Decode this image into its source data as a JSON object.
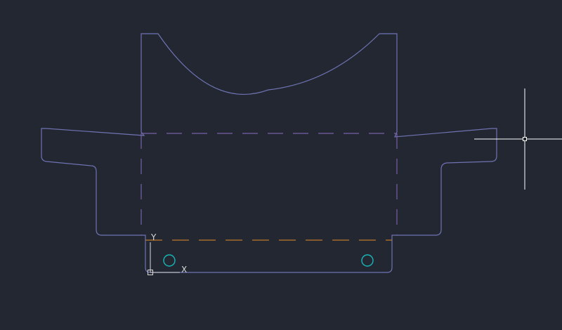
{
  "canvas": {
    "background": "#222732"
  },
  "colors": {
    "outline": "#6f73b2",
    "hidden_purple": "#7a5fa6",
    "hidden_orange": "#c07a2a",
    "circle": "#19b6b6",
    "crosshair": "#ffffff",
    "ucs": "#d8d8d8"
  },
  "ucs": {
    "x_label": "X",
    "y_label": "Y"
  },
  "icons": {
    "crosshair": "crosshair-cursor-icon",
    "ucs": "ucs-axes-icon"
  }
}
